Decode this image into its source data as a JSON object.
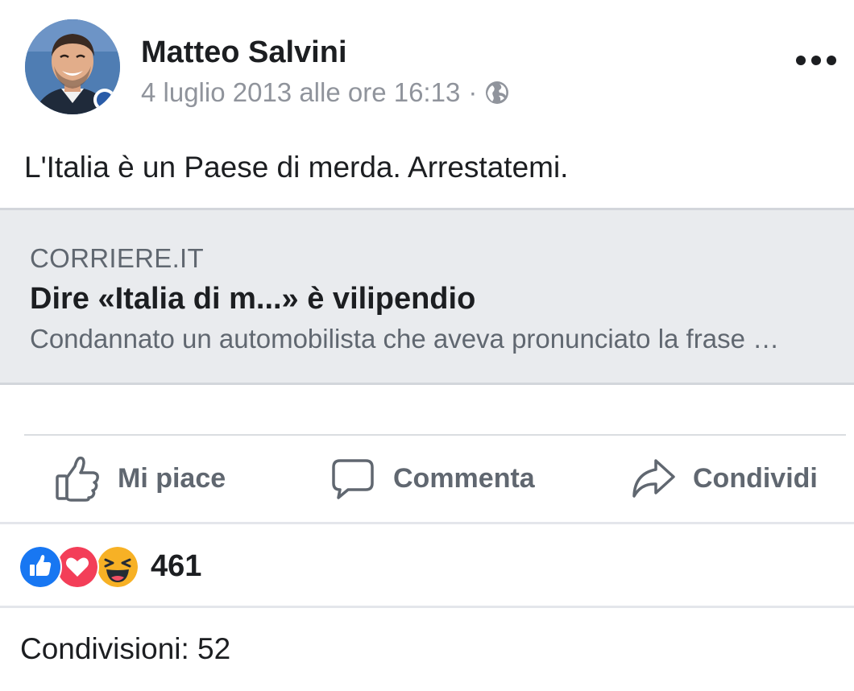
{
  "post": {
    "author": "Matteo Salvini",
    "timestamp": "4 luglio 2013 alle ore 16:13",
    "separator": "·",
    "privacy_icon": "globe-icon",
    "more_icon": "more-dots-icon",
    "text": "L'Italia è un Paese di merda. Arrestatemi."
  },
  "link_preview": {
    "source": "CORRIERE.IT",
    "title": "Dire «Italia di m...» è vilipendio",
    "description": "Condannato un automobilista che aveva pronunciato la frase …"
  },
  "actions": {
    "like": {
      "label": "Mi piace",
      "icon": "thumbs-up-icon"
    },
    "comment": {
      "label": "Commenta",
      "icon": "comment-bubble-icon"
    },
    "share": {
      "label": "Condividi",
      "icon": "share-arrow-icon"
    }
  },
  "reactions": {
    "icons": [
      "like-reaction-icon",
      "love-reaction-icon",
      "haha-reaction-icon"
    ],
    "count": "461"
  },
  "shares": {
    "text": "Condivisioni: 52"
  },
  "colors": {
    "meta_text": "#90949c",
    "action_text": "#606770",
    "preview_bg": "#e9ebee",
    "like_blue": "#1877f2",
    "love_red": "#f33e58",
    "haha_yellow": "#f7b125"
  }
}
